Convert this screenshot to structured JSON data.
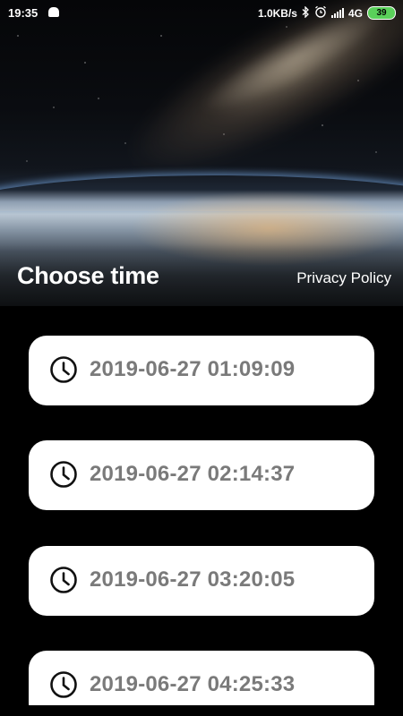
{
  "status_bar": {
    "time": "19:35",
    "network_speed": "1.0KB/s",
    "network_type": "4G",
    "battery": "39",
    "icons": [
      "notification-icon",
      "bluetooth-icon",
      "alarm-icon",
      "signal-icon",
      "battery-icon"
    ]
  },
  "header": {
    "title": "Choose time",
    "privacy_label": "Privacy Policy"
  },
  "times": [
    "2019-06-27 01:09:09",
    "2019-06-27 02:14:37",
    "2019-06-27 03:20:05",
    "2019-06-27 04:25:33"
  ],
  "colors": {
    "background": "#000000",
    "card": "#ffffff",
    "time_text": "#7a7a7a",
    "icon": "#111111"
  }
}
